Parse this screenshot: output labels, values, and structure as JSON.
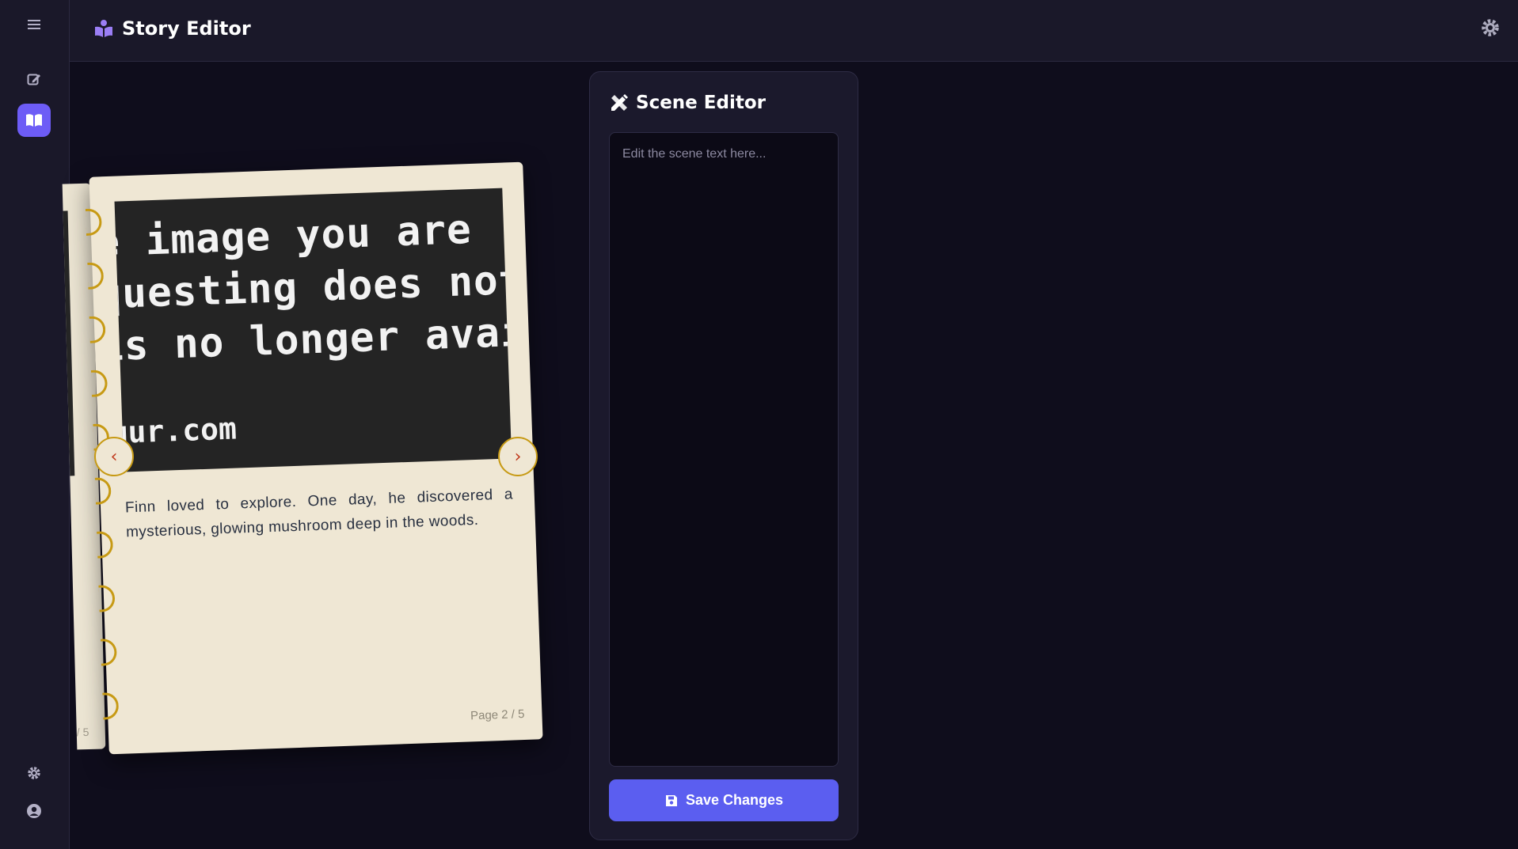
{
  "app": {
    "title": "Story Editor"
  },
  "sidebar": {
    "items": [
      {
        "icon": "menu-icon"
      },
      {
        "icon": "edit-icon"
      },
      {
        "icon": "book-icon",
        "active": true
      },
      {
        "icon": "gear-icon"
      },
      {
        "icon": "user-circle-icon"
      }
    ]
  },
  "book": {
    "image_text": {
      "line1": "e image you are",
      "line2": "questing does not ex",
      "line3": "is no longer availabl",
      "domain": "gur.com"
    },
    "page_text": "Finn loved to explore. One day, he discovered a mysterious, glowing mushroom deep in the woods.",
    "page_number": "Page 2 / 5",
    "back_page_number": "/ 5",
    "prev_label": "‹",
    "next_label": "›"
  },
  "editor": {
    "title": "Scene Editor",
    "placeholder": "Edit the scene text here...",
    "save_label": "Save Changes"
  },
  "colors": {
    "accent": "#6d5cf6",
    "save_button": "#5b5ef0",
    "page": "#efe7d4",
    "ring": "#c79a14",
    "nav_arrow": "#c0391b"
  }
}
